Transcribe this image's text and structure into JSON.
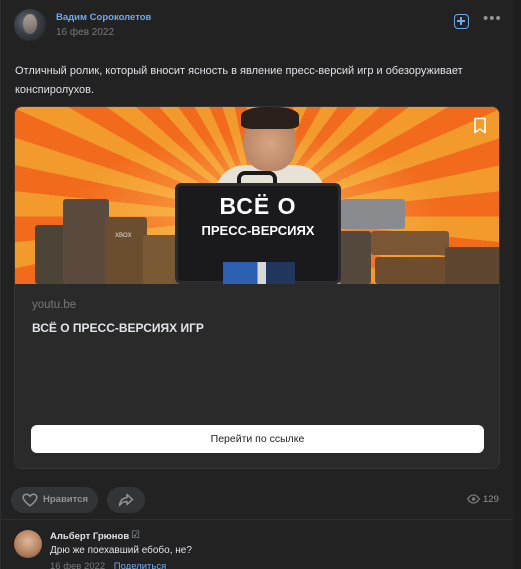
{
  "post": {
    "author": "Вадим Сороколетов",
    "date": "16 фев 2022",
    "text": "Отличный ролик, который вносит ясность в явление пресс-версий игр и обезоруживает конспиролухов.",
    "attachment": {
      "thumbnail_title_line1": "ВСЁ О",
      "thumbnail_title_line2": "ПРЕСС-ВЕРСИЯХ",
      "thumbnail_small_text": "XBOX",
      "domain": "youtu.be",
      "title": "ВСЁ О ПРЕСС-ВЕРСИЯХ ИГР",
      "button_label": "Перейти по ссылке"
    },
    "actions": {
      "like_label": "Нравится",
      "views_count": "129"
    }
  },
  "comment": {
    "author": "Альберт Грюнов",
    "badge": "☑",
    "text": "Дрю же поехавший ебобо, не?",
    "date": "16 фев 2022",
    "share_label": "Поделиться"
  },
  "colors": {
    "background": "#222223",
    "link_blue": "#71aaeb",
    "text_primary": "#e1e3e6",
    "text_secondary": "#76787a",
    "button_bg": "#333435"
  },
  "icons": [
    "add-icon",
    "more-icon",
    "bookmark-icon",
    "heart-icon",
    "share-icon",
    "eye-icon"
  ]
}
